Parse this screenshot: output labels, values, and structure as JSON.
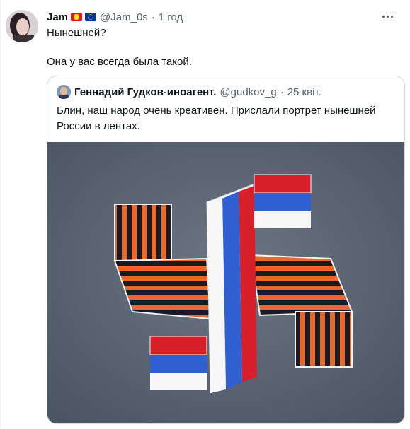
{
  "tweet": {
    "user_name": "Jam⁣",
    "handle": "@Jam_0s",
    "separator": "·",
    "time": "1 год",
    "text_line1": "Нынешней?",
    "text_line2": "Она у вас всегда была такой."
  },
  "quote": {
    "user_name": "Геннадий Гудков-иноагент.",
    "handle": "@gudkov_g",
    "separator": "·",
    "date": "25 квіт.",
    "text": "Блин, наш народ очень креативен. Прислали портрет нынешней России в лентах."
  },
  "icons": {
    "more": "more-dots-icon",
    "flags": [
      "kyrgyzstan-flag-icon",
      "eu-flag-icon"
    ]
  },
  "colors": {
    "text": "#0f1419",
    "muted": "#536471",
    "border": "#cfd9de",
    "image_bg": "#57616f",
    "ribbon_orange": "#e8692a",
    "ribbon_black": "#1a1a24",
    "flag_white": "#f2f2f2",
    "flag_blue": "#2f5fd0",
    "flag_red": "#d8202a"
  }
}
